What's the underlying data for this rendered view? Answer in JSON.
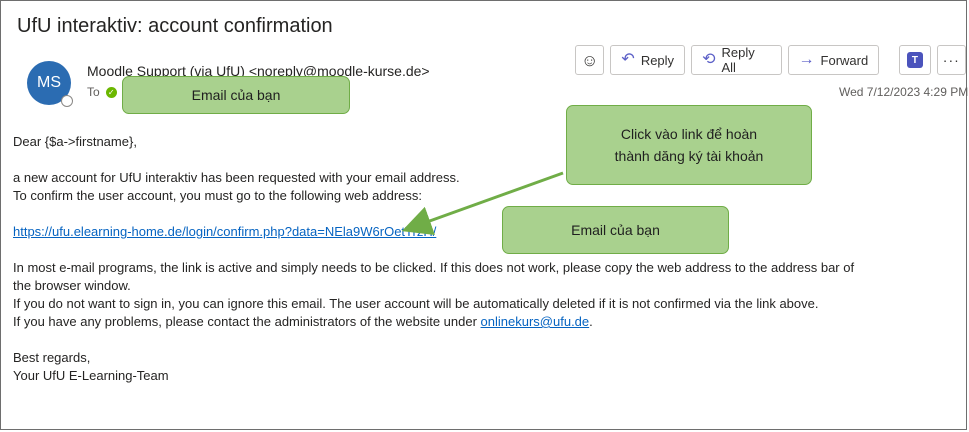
{
  "subject": "UfU interaktiv: account confirmation",
  "sender": {
    "initials": "MS",
    "display": "Moodle Support (via UfU) <noreply@moodle-kurse.de>",
    "to_label": "To"
  },
  "toolbar": {
    "emoji_icon": "☺",
    "reply_icon": "↶",
    "reply_label": "Reply",
    "reply_all_icon": "⟲",
    "reply_all_label": "Reply All",
    "forward_icon": "→",
    "forward_label": "Forward",
    "teams_label": "T",
    "more_label": "···"
  },
  "date": "Wed 7/12/2023 4:29 PM",
  "body": {
    "greeting": "Dear {$a->firstname},",
    "line1": "a new account for UfU interaktiv has been requested with your email address.",
    "line2": "To confirm the user account, you must go to the following web address:",
    "link": "https://ufu.elearning-home.de/login/confirm.php?data=NEla9W6rOetTrzH/",
    "para2a": "In most e-mail programs, the link is active and simply needs to be clicked. If this does not work, please copy the web address to the address bar of",
    "para2b": "the browser window.",
    "para3": "If you do not want to sign in, you can ignore this email. The user account will be automatically deleted if it is not confirmed via the link above.",
    "para4_prefix": "If you have any problems, please contact the administrators of the website under ",
    "admin_email": "onlinekurs@ufu.de",
    "para4_suffix": ".",
    "closing": "Best regards,",
    "signature": "Your UfU E-Learning-Team"
  },
  "callouts": {
    "email_top": "Email của bạn",
    "click_link_line1": "Click vào link để hoàn",
    "click_link_line2": "thành dăng ký tài khoản",
    "email_link": "Email của bạn"
  },
  "colors": {
    "callout_fill": "#a9d18e",
    "callout_border": "#70ad47",
    "link": "#0563c1",
    "avatar": "#2b6cb2"
  }
}
